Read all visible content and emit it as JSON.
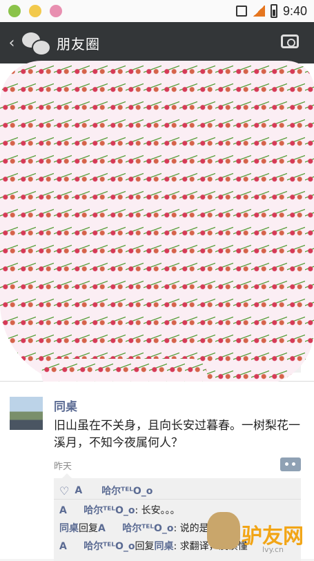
{
  "statusbar": {
    "time": "9:40"
  },
  "titlebar": {
    "back": "‹",
    "title": "朋友圈"
  },
  "post": {
    "author": "同桌",
    "text": "旧山虽在不关身，且向长安过暮春。一树梨花一溪月，不知今夜属何人？",
    "time": "昨天",
    "likes": {
      "heart": "♡",
      "names": [
        "A",
        "哈尔ᵀᴱᴸO_o"
      ]
    },
    "comments": [
      {
        "user": "A",
        "target": "",
        "reply_word": "",
        "user2": "哈尔ᵀᴱᴸO_o",
        "text": ": 长安。。。"
      },
      {
        "user": "同桌",
        "reply_word": "回复",
        "user2": "A",
        "user3": "哈尔ᵀᴱᴸO_o",
        "text": ": 说的是"
      },
      {
        "user": "A",
        "user2": "哈尔ᵀᴱᴸO_o",
        "reply_word": "回复",
        "user3": "同桌",
        "text": ": 求翻译，没读懂"
      }
    ]
  },
  "watermark": {
    "text": "驴友网",
    "url": "lvy.cn"
  },
  "colors": {
    "titlebar": "#333638",
    "name": "#5b6b93",
    "accent": "#8fa1b4",
    "cover": "#fbeef4"
  }
}
